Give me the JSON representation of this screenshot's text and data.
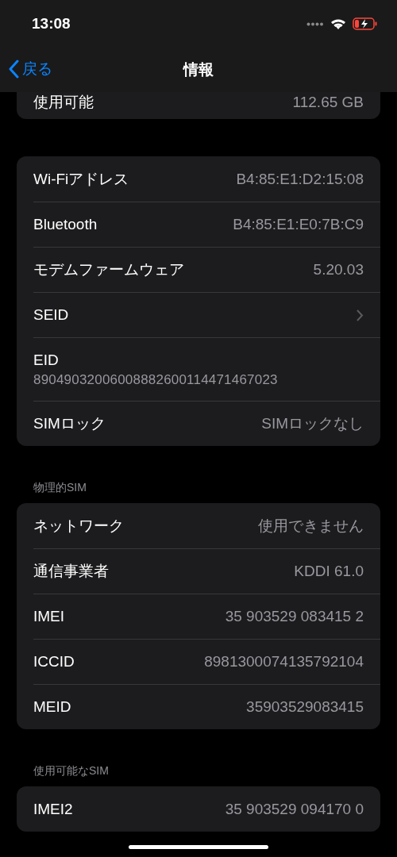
{
  "status_bar": {
    "time": "13:08"
  },
  "nav": {
    "back": "戻る",
    "title": "情報"
  },
  "groups": [
    {
      "cut_top": true,
      "rows": [
        {
          "kind": "value",
          "label": "使用可能",
          "value": "112.65 GB"
        }
      ]
    },
    {
      "rows": [
        {
          "kind": "value",
          "label": "Wi-Fiアドレス",
          "value": "B4:85:E1:D2:15:08"
        },
        {
          "kind": "value",
          "label": "Bluetooth",
          "value": "B4:85:E1:E0:7B:C9"
        },
        {
          "kind": "value",
          "label": "モデムファームウェア",
          "value": "5.20.03"
        },
        {
          "kind": "chevron",
          "label": "SEID"
        },
        {
          "kind": "stacked",
          "label": "EID",
          "value": "89049032006008882600114471467023"
        },
        {
          "kind": "value",
          "label": "SIMロック",
          "value": "SIMロックなし"
        }
      ]
    },
    {
      "header": "物理的SIM",
      "rows": [
        {
          "kind": "value",
          "label": "ネットワーク",
          "value": "使用できません"
        },
        {
          "kind": "value",
          "label": "通信事業者",
          "value": "KDDI 61.0"
        },
        {
          "kind": "value",
          "label": "IMEI",
          "value": "35 903529 083415 2"
        },
        {
          "kind": "value",
          "label": "ICCID",
          "value": "8981300074135792104"
        },
        {
          "kind": "value",
          "label": "MEID",
          "value": "35903529083415"
        }
      ]
    },
    {
      "header": "使用可能なSIM",
      "rows": [
        {
          "kind": "value",
          "label": "IMEI2",
          "value": "35 903529 094170 0"
        }
      ]
    }
  ]
}
